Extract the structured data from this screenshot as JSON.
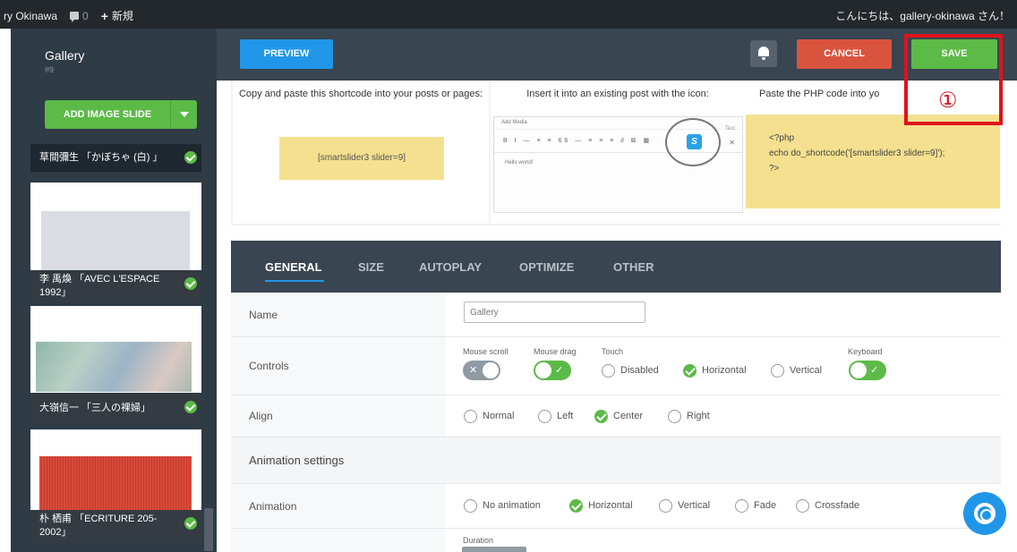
{
  "admin_bar": {
    "site_name": "ry Okinawa",
    "comments_count": "0",
    "new_label": "新規",
    "greeting": "こんにちは、gallery-okinawa さん！"
  },
  "sidebar": {
    "title": "Gallery",
    "subtitle": "#9",
    "add_slide_label": "ADD IMAGE SLIDE",
    "slides": [
      {
        "caption": "草間彌生 「かぼちゃ (白) 」"
      },
      {
        "caption": "李 禹煥 「AVEC L'ESPACE 1992」"
      },
      {
        "caption": "大嶺信一 「三人の裸婦」"
      },
      {
        "caption": "朴 栖甫 「ECRITURE 205-2002」"
      }
    ]
  },
  "toolbar": {
    "preview_label": "PREVIEW",
    "cancel_label": "CANCEL",
    "save_label": "SAVE"
  },
  "annotation": {
    "number": "①"
  },
  "shortcode": {
    "col1_title": "Copy and paste this shortcode into your posts or pages:",
    "shortcode_text": "[smartslider3 slider=9]",
    "col2_title": "Insert it into an existing post with the icon:",
    "editor_add_media": "Add Media",
    "editor_text_tab": "Text",
    "editor_toolbar": "B I — ≡ ≡ 66 — ≡ ≡ ≡ ∂ ⊠ ▦",
    "editor_body": "Hello world!",
    "smartslider_icon": "S",
    "col3_title": "Paste the PHP code into yo",
    "php_line1": "<?php",
    "php_line2": "echo do_shortcode('[smartslider3 slider=9]');",
    "php_line3": "?>"
  },
  "tabs": [
    "GENERAL",
    "SIZE",
    "AUTOPLAY",
    "OPTIMIZE",
    "OTHER"
  ],
  "settings": {
    "name_label": "Name",
    "name_value": "Gallery",
    "controls_label": "Controls",
    "mouse_scroll_label": "Mouse scroll",
    "mouse_drag_label": "Mouse drag",
    "touch_label": "Touch",
    "keyboard_label": "Keyboard",
    "touch_options": [
      "Disabled",
      "Horizontal",
      "Vertical"
    ],
    "touch_selected": "Horizontal",
    "align_label": "Align",
    "align_options": [
      "Normal",
      "Left",
      "Center",
      "Right"
    ],
    "align_selected": "Center",
    "animation_settings_title": "Animation settings",
    "animation_label": "Animation",
    "animation_options": [
      "No animation",
      "Horizontal",
      "Vertical",
      "Fade",
      "Crossfade"
    ],
    "animation_selected": "Horizontal",
    "duration_label": "Duration",
    "next_row_label_partial": "Duration"
  }
}
